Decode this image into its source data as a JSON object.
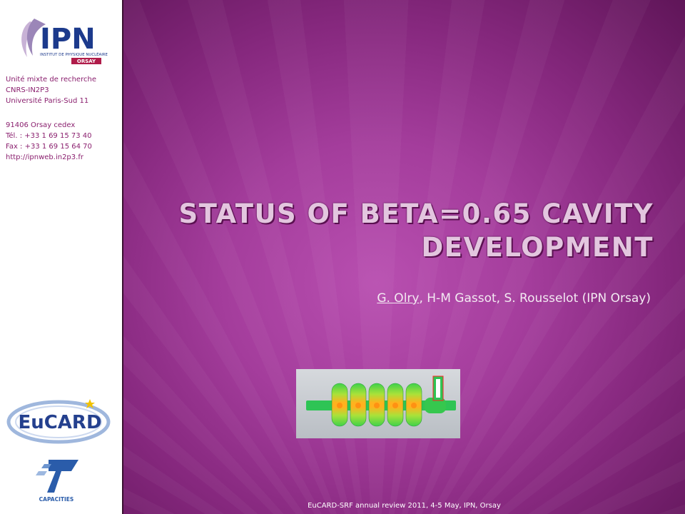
{
  "sidebar": {
    "logo_main": "IPN",
    "logo_sub1": "INSTITUT DE PHYSIQUE NUCLÉAIRE",
    "logo_sub2": "ORSAY",
    "affiliation": [
      "Unité mixte de recherche",
      "CNRS-IN2P3",
      "Université Paris-Sud 11"
    ],
    "contact": [
      "91406 Orsay cedex",
      "Tél. : +33 1 69 15 73 40",
      "Fax : +33 1 69 15 64 70",
      "http://ipnweb.in2p3.fr"
    ],
    "eucard_logo_text": "EuCARD",
    "fp7_logo_text": "CAPACITIES"
  },
  "slide": {
    "title_line1": "STATUS OF BETA=0.65 CAVITY",
    "title_line2": "DEVELOPMENT",
    "subtitle_main_author": "G. Olry",
    "subtitle_rest": ", H-M Gassot, S. Rousselot (IPN Orsay)",
    "footer": "EuCARD-SRF annual review 2011, 4-5 May, IPN, Orsay"
  },
  "colors": {
    "slide_bg": "#a43d9c",
    "title": "#e3c6df",
    "sidebar_text": "#8a1f6e",
    "ipn_blue": "#1c3a8c"
  }
}
